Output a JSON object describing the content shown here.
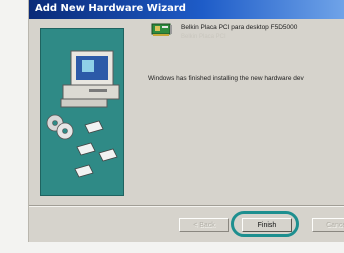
{
  "window": {
    "title": "Add New Hardware Wizard"
  },
  "device": {
    "name": "Belkin Placa PCI para desktop F5D5000",
    "subtitle": "Belkin Placa PCI"
  },
  "message": "Windows has finished installing the new hardware dev",
  "buttons": {
    "back": "< Back",
    "finish": "Finish",
    "cancel": "Cancel"
  },
  "colors": {
    "banner": "#2f8a86",
    "highlight_ring": "#1e8f8f",
    "titlebar_start": "#0a2a78"
  },
  "icons": {
    "banner": [
      "computer-icon",
      "cd-disc-icon",
      "floppy-disk-icon"
    ],
    "device": "network-card-icon"
  }
}
